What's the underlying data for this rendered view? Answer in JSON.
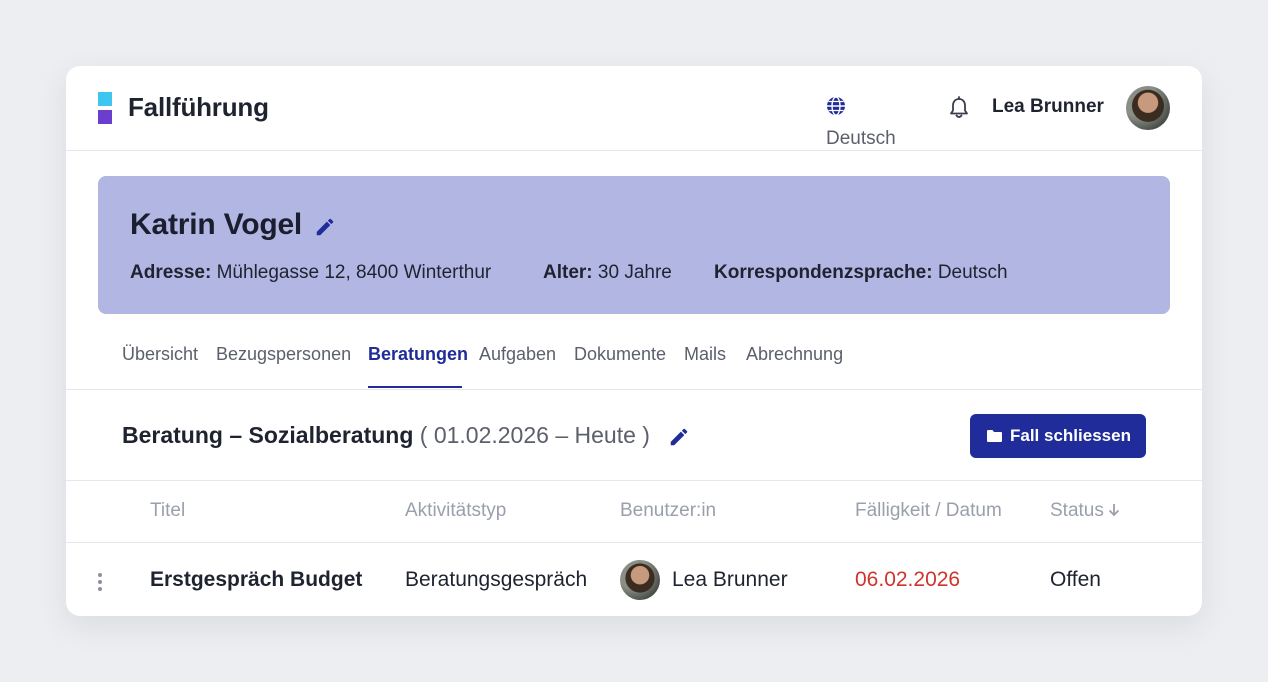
{
  "header": {
    "app_title": "Fallführung",
    "language_label": "Deutsch",
    "user_name": "Lea Brunner"
  },
  "person": {
    "name": "Katrin Vogel",
    "address_label": "Adresse:",
    "address_value": "Mühlegasse 12, 8400 Winterthur",
    "age_label": "Alter:",
    "age_value": "30 Jahre",
    "language_label": "Korrespondenzsprache:",
    "language_value": "Deutsch"
  },
  "tabs": [
    {
      "label": "Übersicht",
      "active": false
    },
    {
      "label": "Bezugspersonen",
      "active": false
    },
    {
      "label": "Beratungen",
      "active": true
    },
    {
      "label": "Aufgaben",
      "active": false
    },
    {
      "label": "Dokumente",
      "active": false
    },
    {
      "label": "Mails",
      "active": false
    },
    {
      "label": "Abrechnung",
      "active": false
    }
  ],
  "section": {
    "title": "Beratung – Sozialberatung",
    "dates": "( 01.02.2026 – Heute )",
    "close_button_label": "Fall schliessen"
  },
  "table": {
    "columns": [
      "Titel",
      "Aktivitätstyp",
      "Benutzer:in",
      "Fälligkeit / Datum",
      "Status"
    ],
    "rows": [
      {
        "title": "Erstgespräch Budget",
        "type": "Beratungsgespräch",
        "user": "Lea Brunner",
        "due": "06.02.2026",
        "status": "Offen"
      }
    ]
  },
  "colors": {
    "accent": "#1f2c99",
    "banner": "#b2b6e3",
    "due_overdue": "#d0342c",
    "logo_top": "#3ec5f0",
    "logo_bottom": "#6a3fd0"
  },
  "icons": [
    "logo-mark",
    "globe-icon",
    "bell-icon",
    "avatar",
    "pencil-icon",
    "folder-icon",
    "sort-down-icon",
    "kebab-menu-icon"
  ]
}
